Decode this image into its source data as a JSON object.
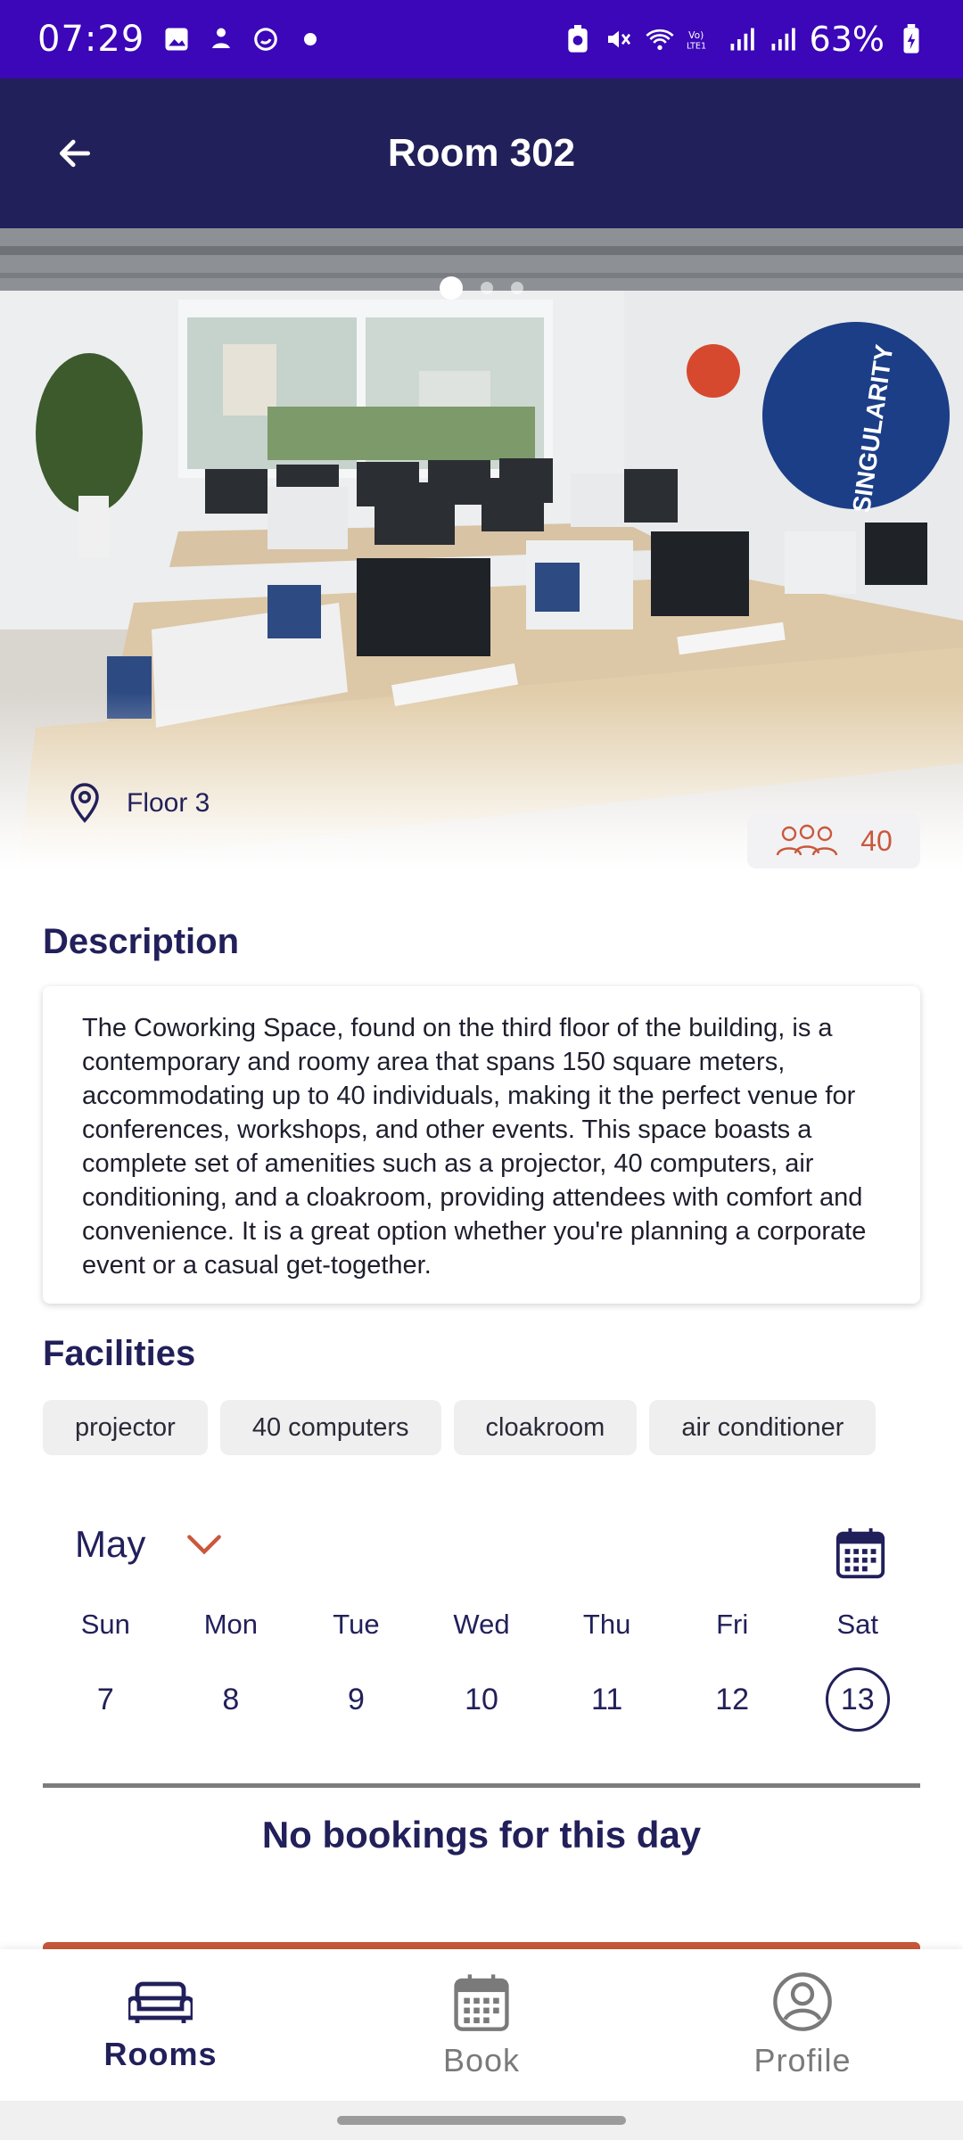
{
  "status_bar": {
    "time": "07:29",
    "battery": "63%",
    "left_icons": [
      "gallery-icon",
      "app-icon",
      "sync-icon",
      "dot-icon"
    ],
    "right_icons": [
      "battery-saver-icon",
      "mute-icon",
      "wifi-icon",
      "volte-icon",
      "signal-icon",
      "signal-icon",
      "battery-icon"
    ]
  },
  "header": {
    "title": "Room 302"
  },
  "hero": {
    "floor": "Floor 3",
    "capacity": "40",
    "carousel_dots": 3,
    "active_dot": 0,
    "wall_text": "SINGULARITY"
  },
  "description": {
    "title": "Description",
    "text": "The Coworking Space, found on the third floor of the building, is a contemporary and roomy area that spans 150 square meters, accommodating up to 40 individuals, making it the perfect venue for conferences, workshops, and other events. This space boasts a complete set of amenities such as a projector, 40 computers, air conditioning, and a cloakroom, providing attendees with comfort and convenience. It is a great option whether you're planning a corporate event or a casual get-together."
  },
  "facilities": {
    "title": "Facilities",
    "items": [
      "projector",
      "40 computers",
      "cloakroom",
      "air conditioner"
    ]
  },
  "calendar": {
    "month": "May",
    "days": [
      {
        "name": "Sun",
        "num": "7"
      },
      {
        "name": "Mon",
        "num": "8"
      },
      {
        "name": "Tue",
        "num": "9"
      },
      {
        "name": "Wed",
        "num": "10"
      },
      {
        "name": "Thu",
        "num": "11"
      },
      {
        "name": "Fri",
        "num": "12"
      },
      {
        "name": "Sat",
        "num": "13"
      }
    ],
    "selected_index": 6
  },
  "bookings": {
    "empty_message": "No bookings for this day"
  },
  "nav": {
    "items": [
      {
        "label": "Rooms",
        "icon": "sofa-icon",
        "active": true
      },
      {
        "label": "Book",
        "icon": "calendar-icon",
        "active": false
      },
      {
        "label": "Profile",
        "icon": "profile-icon",
        "active": false
      }
    ]
  },
  "colors": {
    "status_bar": "#3b07b8",
    "header": "#22205a",
    "accent": "#c9583c",
    "text_primary": "#22205a"
  }
}
